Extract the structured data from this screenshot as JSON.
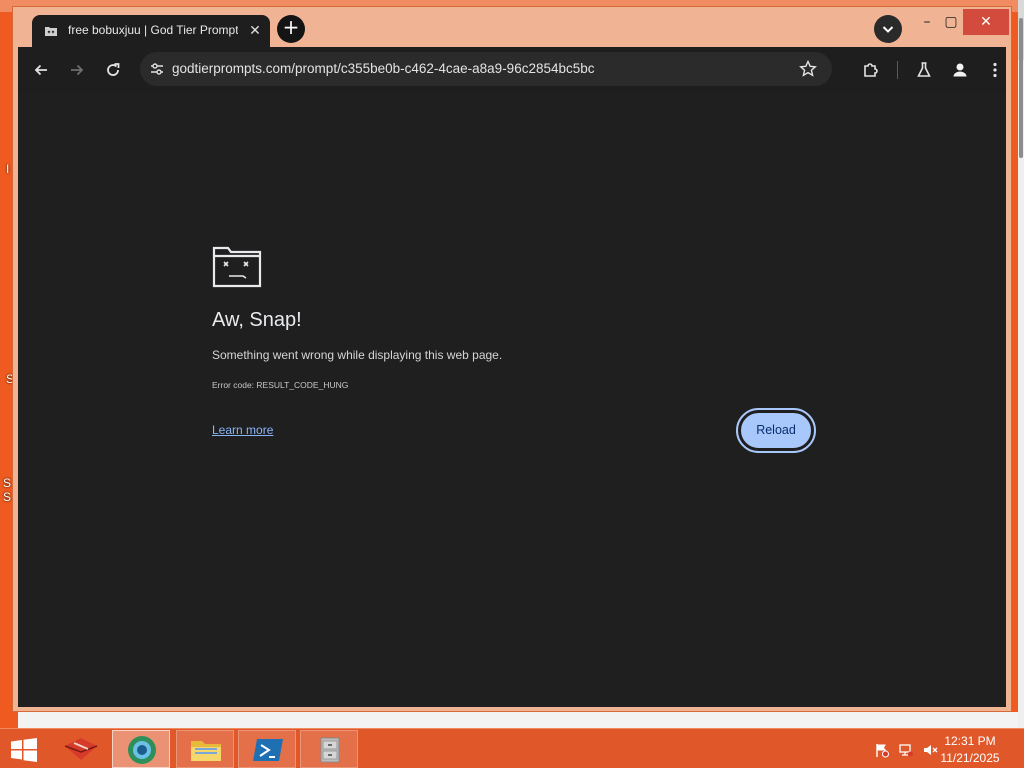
{
  "desktop": {
    "fragments": [
      "I",
      "S",
      "S",
      "S"
    ]
  },
  "browser": {
    "tab": {
      "title": "free bobuxjuu | God Tier Prompts",
      "close_glyph": "✕"
    },
    "new_tab_glyph": "+",
    "window_controls": {
      "minimize": "–",
      "maximize": "▢",
      "close": "✕"
    },
    "omnibox": {
      "url": "godtierprompts.com/prompt/c355be0b-c462-4cae-a8a9-96c2854bc5bc"
    },
    "icons": {
      "back": "back-arrow-icon",
      "forward": "forward-arrow-icon",
      "reload": "reload-icon",
      "site_info": "tune-icon",
      "bookmark": "star-icon",
      "extensions": "puzzle-icon",
      "labs": "flask-icon",
      "profile": "profile-icon",
      "menu": "kebab-menu-icon"
    }
  },
  "error_page": {
    "title": "Aw, Snap!",
    "message": "Something went wrong while displaying this web page.",
    "error_code": "Error code: RESULT_CODE_HUNG",
    "learn_more": "Learn more",
    "reload_button": "Reload"
  },
  "taskbar": {
    "clock": {
      "time": "12:31 PM",
      "date": "11/21/2025"
    },
    "colors": {
      "accent": "#a8c7fa",
      "desktop": "#ee5a1f",
      "taskbar": "#e0582a"
    }
  }
}
